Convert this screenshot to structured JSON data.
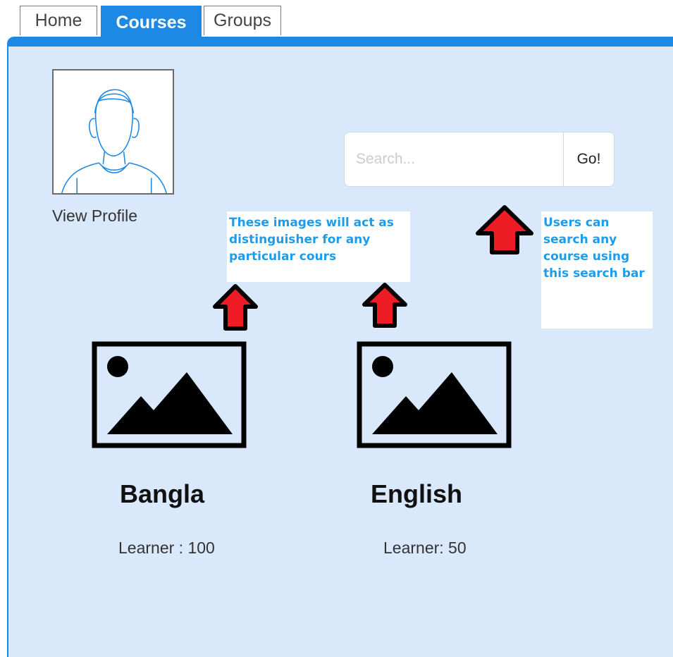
{
  "tabs": [
    {
      "label": "Home",
      "active": false
    },
    {
      "label": "Courses",
      "active": true
    },
    {
      "label": "Groups",
      "active": false
    }
  ],
  "profile": {
    "avatar_icon": "person-avatar-icon",
    "view_profile_label": "View Profile"
  },
  "search": {
    "placeholder": "Search...",
    "value": "",
    "button_label": "Go!"
  },
  "annotations": {
    "images_note": "These images will act as distinguisher for any particular cours",
    "search_note": "Users can search any course using this search bar"
  },
  "courses": [
    {
      "title": "Bangla",
      "learners": "Learner : 100",
      "image_icon": "image-placeholder-icon"
    },
    {
      "title": "English",
      "learners": "Learner: 50",
      "image_icon": "image-placeholder-icon"
    }
  ],
  "colors": {
    "accent": "#1e88e5",
    "panel_background": "#dae8fb",
    "annotation_text": "#1e9be9",
    "arrow_fill": "#ee1c24"
  }
}
